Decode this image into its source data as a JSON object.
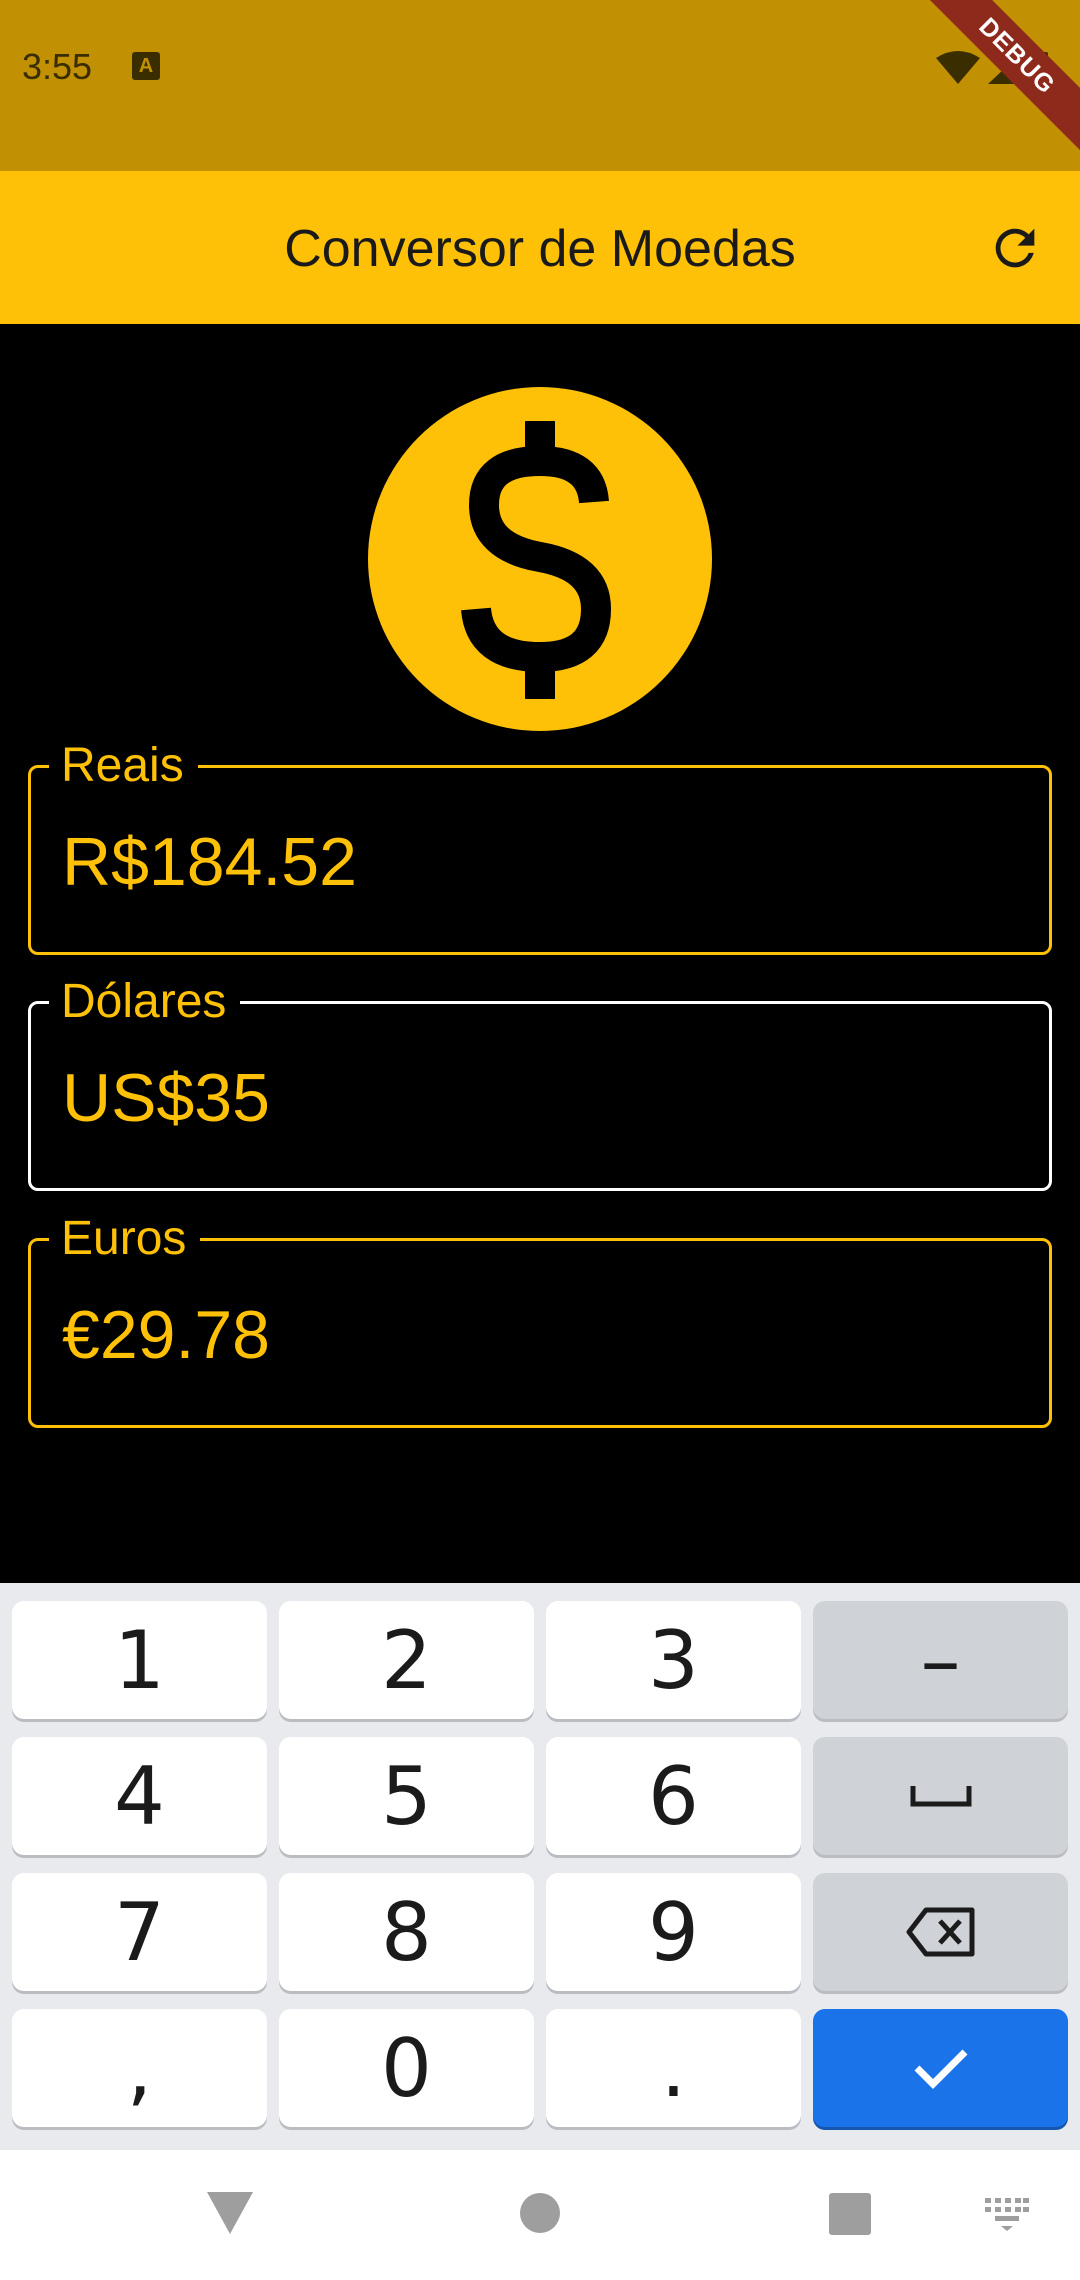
{
  "status_bar": {
    "time": "3:55",
    "notification_icon": "a-icon",
    "debug_banner": "DEBUG",
    "icons": [
      "wifi-icon",
      "cell-signal-icon",
      "battery-icon"
    ]
  },
  "app_bar": {
    "title": "Conversor de Moedas",
    "refresh_icon": "refresh-icon"
  },
  "hero_icon": "dollar-coin-icon",
  "fields": {
    "reais": {
      "label": "Reais",
      "value": "R$184.52"
    },
    "dolares": {
      "label": "Dólares",
      "value": "US$35"
    },
    "euros": {
      "label": "Euros",
      "value": "€29.78"
    }
  },
  "keyboard": {
    "keys": {
      "k1": "1",
      "k2": "2",
      "k3": "3",
      "minus": "–",
      "k4": "4",
      "k5": "5",
      "k6": "6",
      "k7": "7",
      "k8": "8",
      "k9": "9",
      "comma": ",",
      "k0": "0",
      "dot": "."
    },
    "icons": [
      "space-icon",
      "backspace-icon",
      "check-icon"
    ]
  },
  "nav_bar": {
    "icons": [
      "back-icon",
      "home-icon",
      "recents-icon",
      "keyboard-switch-icon"
    ]
  },
  "colors": {
    "accent": "#FFC107",
    "status_bar": "#C19103",
    "background": "#000000",
    "confirm_key": "#1A73E8"
  }
}
